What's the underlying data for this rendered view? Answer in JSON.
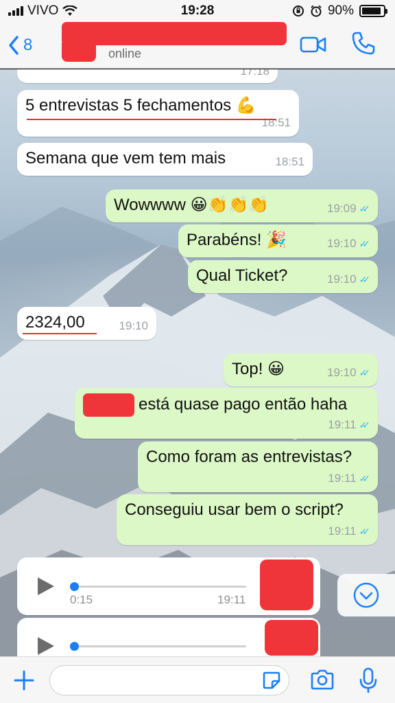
{
  "status_bar": {
    "carrier": "VIVO",
    "time": "19:28",
    "battery": "90%",
    "battery_level": 0.9
  },
  "header": {
    "back_count": "8",
    "contact_status": "online"
  },
  "messages": [
    {
      "dir": "in",
      "text": "",
      "time": "17:18"
    },
    {
      "dir": "in",
      "text": "5 entrevistas 5 fechamentos 💪",
      "time": "18:51"
    },
    {
      "dir": "in",
      "text": "Semana que vem tem mais",
      "time": "18:51"
    },
    {
      "dir": "out",
      "text": "Wowwww 😀👏👏👏",
      "time": "19:09"
    },
    {
      "dir": "out",
      "text": "Parabéns! 🎉",
      "time": "19:10"
    },
    {
      "dir": "out",
      "text": "Qual Ticket?",
      "time": "19:10"
    },
    {
      "dir": "in",
      "text": "2324,00",
      "time": "19:10"
    },
    {
      "dir": "out",
      "text": "Top! 😀",
      "time": "19:10"
    },
    {
      "dir": "out",
      "text": "está quase pago então haha",
      "time": "19:11"
    },
    {
      "dir": "out",
      "text": "Como foram as entrevistas?",
      "time": "19:11"
    },
    {
      "dir": "out",
      "text": "Conseguiu usar bem o script?",
      "time": "19:11"
    }
  ],
  "voice_notes": [
    {
      "duration": "0:15",
      "time": "19:11"
    },
    {
      "duration": "",
      "time": ""
    }
  ],
  "input": {
    "placeholder": ""
  },
  "colors": {
    "accent": "#1b7ef7",
    "outgoing_bubble": "#dcf8c6",
    "incoming_bubble": "#ffffff",
    "read_ticks": "#34b7f1",
    "redaction": "#ef3539"
  }
}
